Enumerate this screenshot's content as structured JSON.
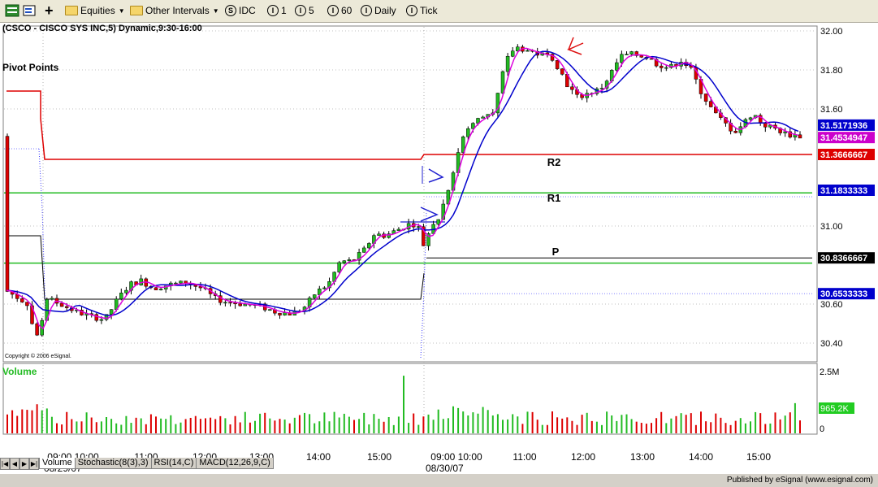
{
  "toolbar": {
    "equities": "Equities",
    "other_intervals": "Other Intervals",
    "idc": "IDC",
    "i1": "1",
    "i5": "5",
    "i60": "60",
    "daily": "Daily",
    "tick": "Tick",
    "symbol_S": "S",
    "symbol_I": "I"
  },
  "chart": {
    "title": "(CSCO - CISCO SYS INC,5) Dynamic,9:30-16:00",
    "study_label": "Pivot Points",
    "copyright": "Copyright © 2006 eSignal.",
    "volume_label": "Volume",
    "published_by": "Published by eSignal (www.esignal.com)"
  },
  "chart_data": {
    "type": "candlestick",
    "y_ticks": [
      "32.00",
      "31.80",
      "31.60",
      "31.00",
      "30.60",
      "30.40"
    ],
    "y_tick_values": [
      32.0,
      31.8,
      31.6,
      31.0,
      30.6,
      30.4
    ],
    "y_range": [
      30.4,
      32.0
    ],
    "price_tags": [
      {
        "label": "31.5171936",
        "value": 31.5171936,
        "color": "#0000cc"
      },
      {
        "label": "31.4534947",
        "value": 31.4534947,
        "color": "#cc00cc"
      },
      {
        "label": "31.3666667",
        "value": 31.3666667,
        "color": "#dd0000"
      },
      {
        "label": "31.1833333",
        "value": 31.1833333,
        "color": "#0000cc"
      },
      {
        "label": "30.8366667",
        "value": 30.8366667,
        "color": "#000000"
      },
      {
        "label": "30.6533333",
        "value": 30.6533333,
        "color": "#0000cc"
      }
    ],
    "pivots": [
      {
        "label": "R2",
        "value": 31.3666667
      },
      {
        "label": "R1",
        "value": 31.1833333
      },
      {
        "label": "P",
        "value": 30.8366667
      }
    ],
    "x_labels_row1": [
      "09:00 10:00",
      "11:00",
      "12:00",
      "13:00",
      "14:00",
      "15:00",
      "09:00 10:00",
      "11:00",
      "12:00",
      "13:00",
      "14:00",
      "15:00"
    ],
    "x_labels_row2": [
      "08/29/07",
      "08/30/07"
    ],
    "volume_ticks": [
      "2.5M",
      "0"
    ],
    "volume_last": "965.2K"
  },
  "tabs": [
    "Volume",
    "Stochastic(8(3),3)",
    "RSI(14,C)",
    "MACD(12,26,9,C)"
  ]
}
